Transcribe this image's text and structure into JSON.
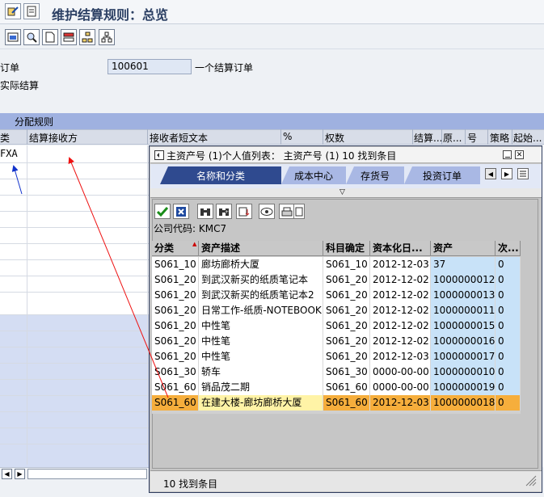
{
  "window": {
    "title": "维护结算规则：总览"
  },
  "form": {
    "order_label": "订单",
    "order_value": "100601",
    "order_desc": "一个结算订单",
    "actual_settlement_label": "实际结算"
  },
  "allocation_tab": "分配规则",
  "table": {
    "headers": [
      "类",
      "结算接收方",
      "接收者短文本",
      "%",
      "权数",
      "结算...",
      "原...",
      "号",
      "策略",
      "起始..."
    ],
    "first_cell": "FXA"
  },
  "popup": {
    "title": "主资产号 (1)个人值列表： 主资产号 (1)   10 找到条目",
    "tabs": [
      "名称和分类",
      "成本中心",
      "存货号",
      "投资订单"
    ],
    "company_label": "公司代码: KMC7",
    "columns": [
      "分类",
      "资产描述",
      "科目确定",
      "资本化日...",
      "资产",
      "次..."
    ],
    "rows": [
      [
        "S061_10",
        "廊坊廊桥大厦",
        "S061_10",
        "2012-12-03",
        "37",
        "0"
      ],
      [
        "S061_20",
        "到武汉新买的纸质笔记本",
        "S061_20",
        "2012-12-02",
        "1000000012",
        "0"
      ],
      [
        "S061_20",
        "到武汉新买的纸质笔记本2",
        "S061_20",
        "2012-12-02",
        "1000000013",
        "0"
      ],
      [
        "S061_20",
        "日常工作-纸质-NOTEBOOK",
        "S061_20",
        "2012-12-02",
        "1000000011",
        "0"
      ],
      [
        "S061_20",
        "中性笔",
        "S061_20",
        "2012-12-02",
        "1000000015",
        "0"
      ],
      [
        "S061_20",
        "中性笔",
        "S061_20",
        "2012-12-02",
        "1000000016",
        "0"
      ],
      [
        "S061_20",
        "中性笔",
        "S061_20",
        "2012-12-03",
        "1000000017",
        "0"
      ],
      [
        "S061_30",
        "轿车",
        "S061_30",
        "0000-00-00",
        "1000000010",
        "0"
      ],
      [
        "S061_60",
        "销品茂二期",
        "S061_60",
        "0000-00-00",
        "1000000019",
        "0"
      ],
      [
        "S061_60",
        "在建大楼-廊坊廊桥大厦",
        "S061_60",
        "2012-12-03",
        "1000000018",
        "0"
      ]
    ],
    "footer": "10 找到条目"
  },
  "colors": {
    "tab_active": "#2f4a8f",
    "selected_row": "#f6ae3c",
    "header_blue": "#9fb1e0"
  }
}
